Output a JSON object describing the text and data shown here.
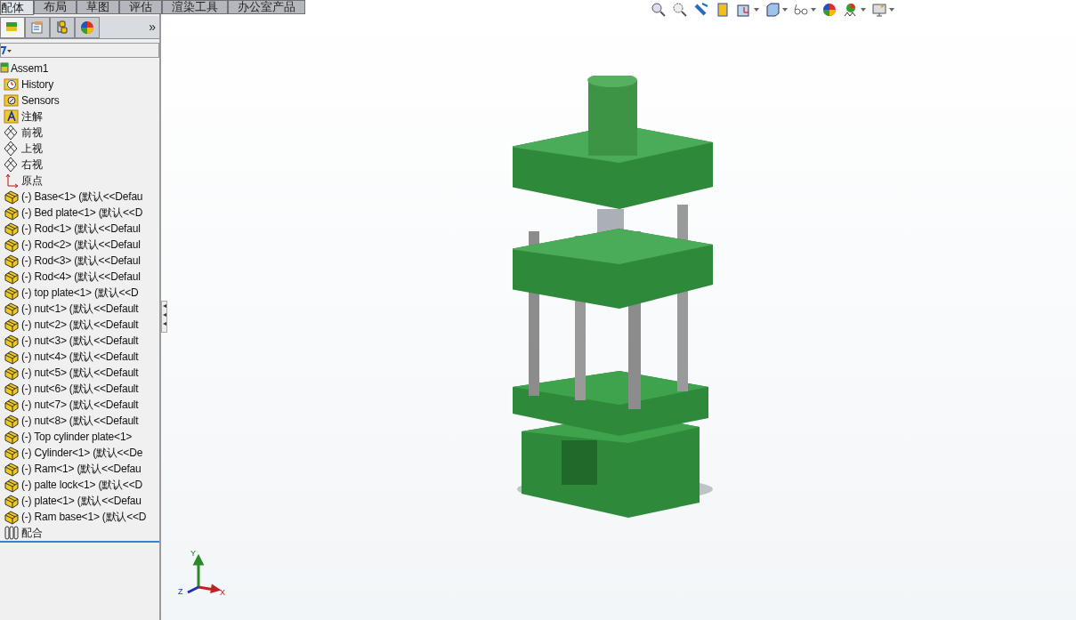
{
  "command_tabs": [
    {
      "label": "配体",
      "selected": true
    },
    {
      "label": "布局",
      "selected": false
    },
    {
      "label": "草图",
      "selected": false
    },
    {
      "label": "评估",
      "selected": false
    },
    {
      "label": "渲染工具",
      "selected": false
    },
    {
      "label": "办公室产品",
      "selected": false
    }
  ],
  "panel_tabs": [
    {
      "kind": "tree",
      "selected": true
    },
    {
      "kind": "property",
      "selected": false
    },
    {
      "kind": "config",
      "selected": false
    },
    {
      "kind": "display",
      "selected": false
    }
  ],
  "panel_more": "»",
  "tree": {
    "label": "Assem1",
    "children": [
      {
        "kind": "history",
        "label": "History"
      },
      {
        "kind": "sensor",
        "label": "Sensors"
      },
      {
        "kind": "annotation",
        "label": "注解"
      },
      {
        "kind": "plane",
        "label": "前视"
      },
      {
        "kind": "plane",
        "label": "上视"
      },
      {
        "kind": "plane",
        "label": "右视"
      },
      {
        "kind": "origin",
        "label": "原点"
      },
      {
        "kind": "part",
        "label": "(-) Base<1> (默认<<Defau"
      },
      {
        "kind": "part",
        "label": "(-) Bed plate<1> (默认<<D"
      },
      {
        "kind": "part",
        "label": "(-) Rod<1> (默认<<Defaul"
      },
      {
        "kind": "part",
        "label": "(-) Rod<2> (默认<<Defaul"
      },
      {
        "kind": "part",
        "label": "(-) Rod<3> (默认<<Defaul"
      },
      {
        "kind": "part",
        "label": "(-) Rod<4> (默认<<Defaul"
      },
      {
        "kind": "part",
        "label": "(-) top plate<1> (默认<<D"
      },
      {
        "kind": "part",
        "label": "(-) nut<1> (默认<<Default"
      },
      {
        "kind": "part",
        "label": "(-) nut<2> (默认<<Default"
      },
      {
        "kind": "part",
        "label": "(-) nut<3> (默认<<Default"
      },
      {
        "kind": "part",
        "label": "(-) nut<4> (默认<<Default"
      },
      {
        "kind": "part",
        "label": "(-) nut<5> (默认<<Default"
      },
      {
        "kind": "part",
        "label": "(-) nut<6> (默认<<Default"
      },
      {
        "kind": "part",
        "label": "(-) nut<7> (默认<<Default"
      },
      {
        "kind": "part",
        "label": "(-) nut<8> (默认<<Default"
      },
      {
        "kind": "part",
        "label": "(-) Top cylinder plate<1>"
      },
      {
        "kind": "part",
        "label": "(-) Cylinder<1> (默认<<De"
      },
      {
        "kind": "part",
        "label": "(-) Ram<1> (默认<<Defau"
      },
      {
        "kind": "part",
        "label": "(-) palte lock<1> (默认<<D"
      },
      {
        "kind": "part",
        "label": "(-) plate<1> (默认<<Defau"
      },
      {
        "kind": "part",
        "label": "(-) Ram base<1> (默认<<D"
      },
      {
        "kind": "mates",
        "label": "配合"
      }
    ]
  },
  "triad": {
    "x": "X",
    "y": "Y",
    "z": "Z"
  }
}
